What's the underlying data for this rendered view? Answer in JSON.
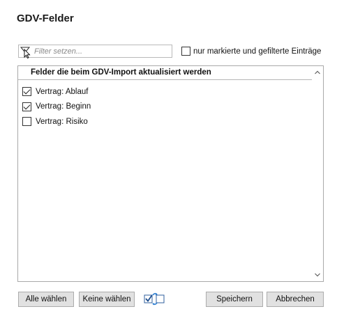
{
  "dialog": {
    "title": "GDV-Felder"
  },
  "filter": {
    "placeholder": "Filter setzen...",
    "value": "",
    "icon": "filter-cursor-icon"
  },
  "only_marked": {
    "label": "nur markierte und gefilterte Einträge",
    "checked": false
  },
  "list": {
    "header": "Felder die beim GDV-Import aktualisiert werden",
    "items": [
      {
        "label": "Vertrag: Ablauf",
        "checked": true
      },
      {
        "label": "Vertrag: Beginn",
        "checked": true
      },
      {
        "label": "Vertrag: Risiko",
        "checked": false
      }
    ],
    "scroll_up_icon": "chevron-up-icon",
    "scroll_down_icon": "chevron-down-icon"
  },
  "buttons": {
    "select_all": "Alle wählen",
    "select_none": "Keine wählen",
    "toggle_icon": "toggle-selection-icon",
    "save": "Speichern",
    "cancel": "Abbrechen"
  },
  "colors": {
    "button_bg": "#e1e1e1",
    "border": "#a9a9a9",
    "icon_blue": "#2f7fd1"
  }
}
